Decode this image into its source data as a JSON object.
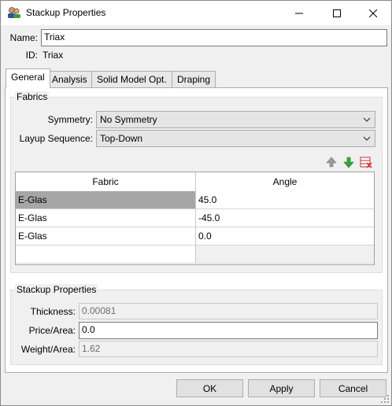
{
  "window": {
    "title": "Stackup Properties"
  },
  "name_field": {
    "label": "Name:",
    "value": "Triax"
  },
  "id_field": {
    "label": "ID:",
    "value": "Triax"
  },
  "tabs": [
    {
      "label": "General",
      "active": true
    },
    {
      "label": "Analysis",
      "active": false
    },
    {
      "label": "Solid Model Opt.",
      "active": false
    },
    {
      "label": "Draping",
      "active": false
    }
  ],
  "fabrics_group": {
    "title": "Fabrics",
    "symmetry": {
      "label": "Symmetry:",
      "value": "No Symmetry"
    },
    "layup_sequence": {
      "label": "Layup Sequence:",
      "value": "Top-Down"
    },
    "table": {
      "columns": [
        "Fabric",
        "Angle"
      ],
      "rows": [
        {
          "fabric": "E-Glas",
          "angle": "45.0",
          "selected": true
        },
        {
          "fabric": "E-Glas",
          "angle": "-45.0",
          "selected": false
        },
        {
          "fabric": "E-Glas",
          "angle": "0.0",
          "selected": false
        }
      ]
    }
  },
  "stackup_group": {
    "title": "Stackup Properties",
    "thickness": {
      "label": "Thickness:",
      "value": "0.00081"
    },
    "price_area": {
      "label": "Price/Area:",
      "value": "0.0"
    },
    "weight_area": {
      "label": "Weight/Area:",
      "value": "1.62"
    }
  },
  "buttons": {
    "ok": "OK",
    "apply": "Apply",
    "cancel": "Cancel"
  },
  "colors": {
    "selected_row": "#a6a6a6",
    "move_up_arrow": "#9a9a9a",
    "move_down_arrow": "#3aa33a",
    "delete_icon": "#d43a3a"
  }
}
